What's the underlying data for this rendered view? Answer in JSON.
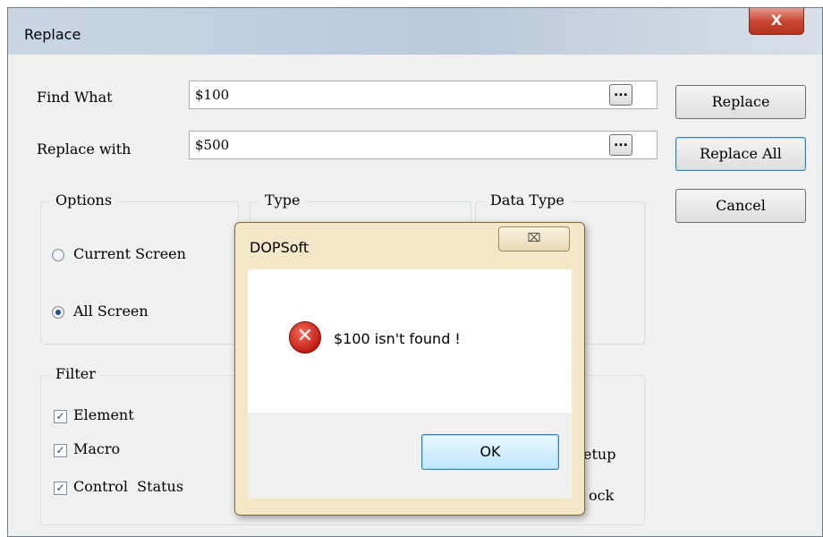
{
  "window": {
    "title": "Replace",
    "close_glyph": "X"
  },
  "find": {
    "label": "Find What",
    "value": "$100",
    "browse_label": "..."
  },
  "replace": {
    "label": "Replace with",
    "value": "$500",
    "browse_label": "..."
  },
  "buttons": {
    "replace": "Replace",
    "replace_all": "Replace All",
    "cancel": "Cancel"
  },
  "options": {
    "title": "Options",
    "current_screen": "Current Screen",
    "all_screen": "All Screen",
    "selected": "All Screen"
  },
  "type_group": {
    "title": "Type"
  },
  "data_type_group": {
    "title": "Data Type"
  },
  "filter": {
    "title": "Filter",
    "items": [
      {
        "label": "Element",
        "checked": true
      },
      {
        "label": "Macro",
        "checked": true
      },
      {
        "label": "Control  Status",
        "checked": true
      }
    ],
    "partial_right": [
      "etup",
      "ock"
    ]
  },
  "dialog": {
    "title": "DOPSoft",
    "close_glyph": "⌧",
    "icon": "error-icon",
    "message": "$100 isn't found !",
    "ok": "OK"
  }
}
